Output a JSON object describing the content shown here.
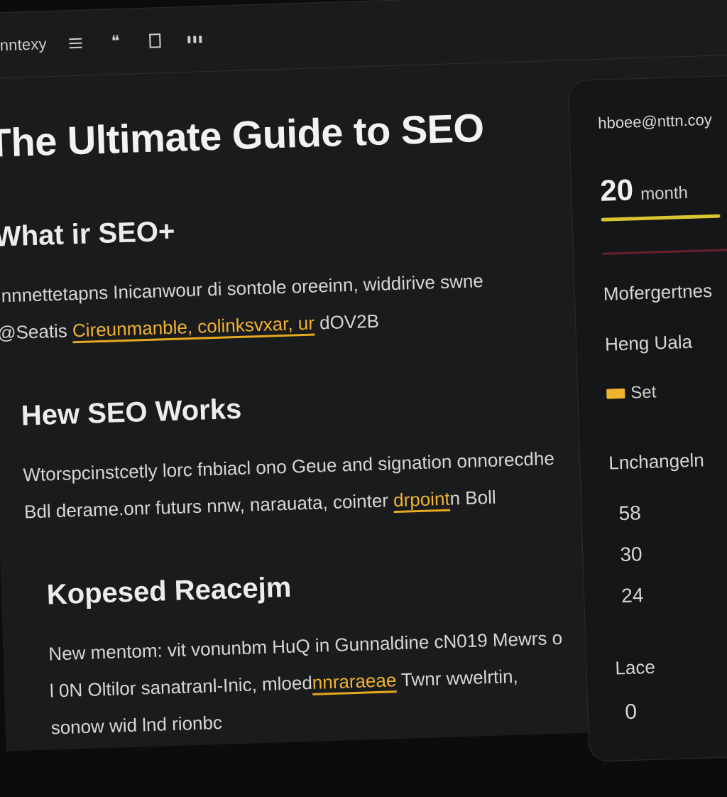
{
  "toolbar": {
    "label": "Inntexy",
    "buttons": [
      {
        "name": "list-icon"
      },
      {
        "name": "quote-icon"
      },
      {
        "name": "code-block-icon"
      },
      {
        "name": "more-icon"
      }
    ]
  },
  "editor": {
    "title": "The Ultimate Guide to SEO",
    "sections": [
      {
        "heading": "What ir SEO+",
        "body_before": "Innnettetapns Inicanwour di sontole oreeinn, widdirive ",
        "link": "Cireunmanble, colinksvxar, ur",
        "body_after": " dOV2B",
        "body_prefix_line2": "swne @Seatis "
      },
      {
        "heading": "Hew SEO Works",
        "body_before": "Wtorspcinstcetly lorc fnbiacl ono Geue and signation onnorecdhe Bdl derame.onr futurs nnw, narauata, cointer ",
        "link": "drpoint",
        "body_after": "n Boll"
      },
      {
        "heading": "Kopesed Reacejm",
        "body_before": "New mentom: vit vonunbm HuQ in Gunnaldine cN019 Mewrs o l 0N Oltilor sanatranl-Inic, mloed",
        "link": "nnraraeae",
        "body_after": " Twnr wwelrtin, sonow wid lnd rionbc"
      }
    ]
  },
  "panel": {
    "email": "hboee@nttn.coy",
    "metric_value": "20",
    "metric_unit": "month",
    "label1": "Mofergertnes",
    "label2": "Heng Uala",
    "legend": "Set",
    "label3": "Lnchangeln",
    "values": [
      "58",
      "30",
      "24"
    ],
    "label4": "Lace",
    "value4": "0"
  },
  "colors": {
    "accent": "#f0b32e",
    "progress_yellow": "#d9c431",
    "progress_red": "#6a1f2c",
    "background": "#1a1b1d"
  }
}
